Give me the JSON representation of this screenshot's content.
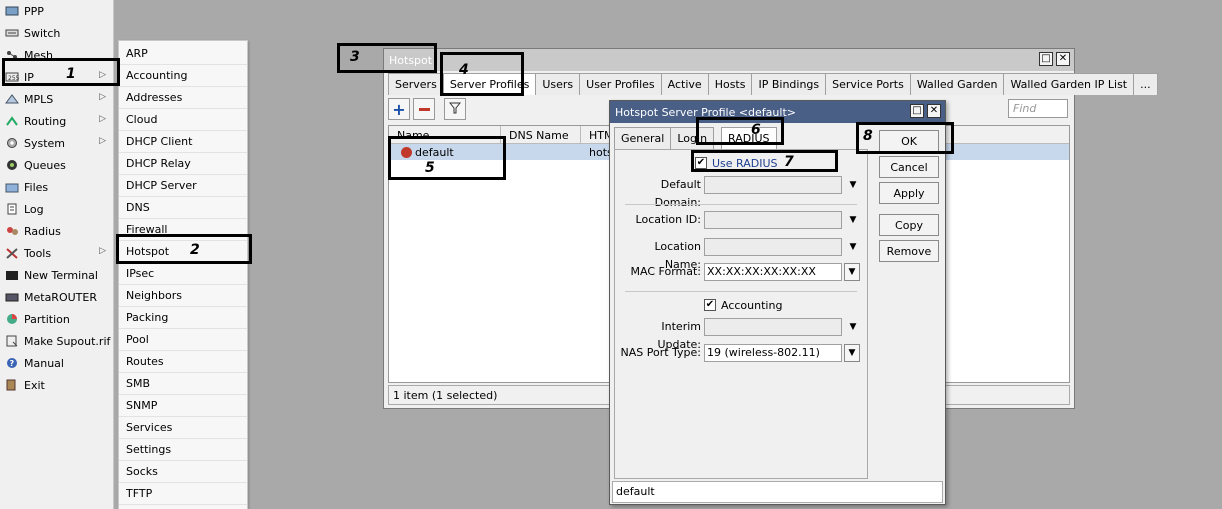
{
  "main_menu": {
    "items": [
      {
        "label": "PPP",
        "icon": "ppp-icon",
        "has_submenu": false
      },
      {
        "label": "Switch",
        "icon": "switch-icon",
        "has_submenu": false
      },
      {
        "label": "Mesh",
        "icon": "mesh-icon",
        "has_submenu": false
      },
      {
        "label": "IP",
        "icon": "ip-icon",
        "has_submenu": true
      },
      {
        "label": "MPLS",
        "icon": "mpls-icon",
        "has_submenu": true
      },
      {
        "label": "Routing",
        "icon": "routing-icon",
        "has_submenu": true
      },
      {
        "label": "System",
        "icon": "gear-icon",
        "has_submenu": true
      },
      {
        "label": "Queues",
        "icon": "queues-icon",
        "has_submenu": false
      },
      {
        "label": "Files",
        "icon": "folder-icon",
        "has_submenu": false
      },
      {
        "label": "Log",
        "icon": "log-icon",
        "has_submenu": false
      },
      {
        "label": "Radius",
        "icon": "radius-icon",
        "has_submenu": false
      },
      {
        "label": "Tools",
        "icon": "tools-icon",
        "has_submenu": true
      },
      {
        "label": "New Terminal",
        "icon": "terminal-icon",
        "has_submenu": false
      },
      {
        "label": "MetaROUTER",
        "icon": "metarouter-icon",
        "has_submenu": false
      },
      {
        "label": "Partition",
        "icon": "partition-icon",
        "has_submenu": false
      },
      {
        "label": "Make Supout.rif",
        "icon": "supout-icon",
        "has_submenu": false
      },
      {
        "label": "Manual",
        "icon": "help-icon",
        "has_submenu": false
      },
      {
        "label": "Exit",
        "icon": "exit-icon",
        "has_submenu": false
      }
    ]
  },
  "ip_submenu": {
    "items": [
      "ARP",
      "Accounting",
      "Addresses",
      "Cloud",
      "DHCP Client",
      "DHCP Relay",
      "DHCP Server",
      "DNS",
      "Firewall",
      "Hotspot",
      "IPsec",
      "Neighbors",
      "Packing",
      "Pool",
      "Routes",
      "SMB",
      "SNMP",
      "Services",
      "Settings",
      "Socks",
      "TFTP"
    ]
  },
  "hotspot_window": {
    "title": "Hotspot",
    "tabs": [
      "Servers",
      "Server Profiles",
      "Users",
      "User Profiles",
      "Active",
      "Hosts",
      "IP Bindings",
      "Service Ports",
      "Walled Garden",
      "Walled Garden IP List",
      "..."
    ],
    "active_tab": "Server Profiles",
    "find_placeholder": "Find",
    "columns": [
      "Name",
      "DNS Name",
      "HTML"
    ],
    "rows": [
      {
        "name": "default",
        "dns_name": "",
        "html": "hotsp"
      }
    ],
    "status": "1 item (1 selected)"
  },
  "dialog": {
    "title": "Hotspot Server Profile <default>",
    "tabs": [
      "General",
      "Login",
      "RADIUS"
    ],
    "active_tab": "RADIUS",
    "use_radius_label": "Use RADIUS",
    "use_radius_checked": "✔",
    "fields": {
      "default_domain_label": "Default Domain:",
      "default_domain_value": "",
      "location_id_label": "Location ID:",
      "location_id_value": "",
      "location_name_label": "Location Name:",
      "location_name_value": "",
      "mac_format_label": "MAC Format:",
      "mac_format_value": "XX:XX:XX:XX:XX:XX",
      "interim_update_label": "Interim Update:",
      "interim_update_value": "",
      "nas_port_type_label": "NAS Port Type:",
      "nas_port_type_value": "19 (wireless-802.11)"
    },
    "accounting_label": "Accounting",
    "accounting_checked": "✔",
    "buttons": {
      "ok": "OK",
      "cancel": "Cancel",
      "apply": "Apply",
      "copy": "Copy",
      "remove": "Remove"
    },
    "status": "default"
  },
  "annotations": [
    "1",
    "2",
    "3",
    "4",
    "5",
    "6",
    "7",
    "8"
  ]
}
